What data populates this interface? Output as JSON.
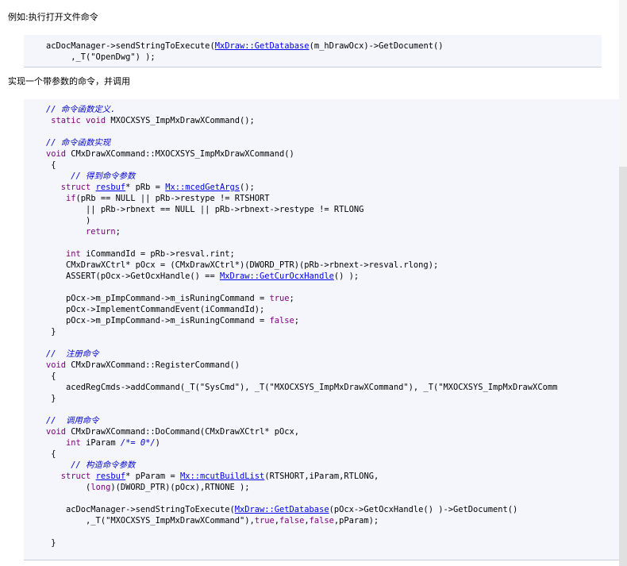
{
  "paragraph_1": "例如:执行打开文件命令",
  "code_1": [
    [
      [
        "t",
        "acDocManager->sendStringToExecute("
      ],
      [
        "l",
        "MxDraw::GetDatabase"
      ],
      [
        "t",
        "(m_hDrawOcx)->GetDocument()"
      ]
    ],
    [
      [
        "t",
        "     ,_T(\"OpenDwg\") );"
      ]
    ]
  ],
  "paragraph_2": "实现一个带参数的命令，并调用",
  "code_2": [
    [
      [
        "c",
        "// 命令函数定义."
      ]
    ],
    [
      [
        "t",
        " "
      ],
      [
        "k",
        "static void"
      ],
      [
        "t",
        " MXOCXSYS_ImpMxDrawXCommand();"
      ]
    ],
    [],
    [
      [
        "c",
        "// 命令函数实现"
      ]
    ],
    [
      [
        "k",
        "void"
      ],
      [
        "t",
        " CMxDrawXCommand::MXOCXSYS_ImpMxDrawXCommand()"
      ]
    ],
    [
      [
        "t",
        " {"
      ]
    ],
    [
      [
        "t",
        "     "
      ],
      [
        "c",
        "// 得到命令参数"
      ]
    ],
    [
      [
        "t",
        "   "
      ],
      [
        "k",
        "struct"
      ],
      [
        "t",
        " "
      ],
      [
        "l",
        "resbuf"
      ],
      [
        "t",
        "* pRb = "
      ],
      [
        "l",
        "Mx::mcedGetArgs"
      ],
      [
        "t",
        "();"
      ]
    ],
    [
      [
        "t",
        "    "
      ],
      [
        "k",
        "if"
      ],
      [
        "t",
        "(pRb == NULL || pRb->restype != RTSHORT"
      ]
    ],
    [
      [
        "t",
        "        || pRb->rbnext == NULL || pRb->rbnext->restype != RTLONG"
      ]
    ],
    [
      [
        "t",
        "        )"
      ]
    ],
    [
      [
        "t",
        "        "
      ],
      [
        "k",
        "return"
      ],
      [
        "t",
        ";"
      ]
    ],
    [],
    [
      [
        "t",
        "    "
      ],
      [
        "k",
        "int"
      ],
      [
        "t",
        " iCommandId = pRb->resval.rint;"
      ]
    ],
    [
      [
        "t",
        "    CMxDrawXCtrl* pOcx = (CMxDrawXCtrl*)(DWORD_PTR)(pRb->rbnext->resval.rlong);"
      ]
    ],
    [
      [
        "t",
        "    ASSERT(pOcx->GetOcxHandle() == "
      ],
      [
        "l",
        "MxDraw::GetCurOcxHandle"
      ],
      [
        "t",
        "() );"
      ]
    ],
    [],
    [
      [
        "t",
        "    pOcx->m_pImpCommand->m_isRuningCommand = "
      ],
      [
        "k",
        "true"
      ],
      [
        "t",
        ";"
      ]
    ],
    [
      [
        "t",
        "    pOcx->ImplementCommandEvent(iCommandId);"
      ]
    ],
    [
      [
        "t",
        "    pOcx->m_pImpCommand->m_isRuningCommand = "
      ],
      [
        "k",
        "false"
      ],
      [
        "t",
        ";"
      ]
    ],
    [
      [
        "t",
        " }"
      ]
    ],
    [],
    [
      [
        "c",
        "//  注册命令"
      ]
    ],
    [
      [
        "k",
        "void"
      ],
      [
        "t",
        " CMxDrawXCommand::RegisterCommand()"
      ]
    ],
    [
      [
        "t",
        " {"
      ]
    ],
    [
      [
        "t",
        "    acedRegCmds->addCommand(_T(\"SysCmd\"), _T(\"MXOCXSYS_ImpMxDrawXCommand\"), _T(\"MXOCXSYS_ImpMxDrawXComm"
      ]
    ],
    [
      [
        "t",
        " }"
      ]
    ],
    [],
    [
      [
        "c",
        "//  调用命令"
      ]
    ],
    [
      [
        "k",
        "void"
      ],
      [
        "t",
        " CMxDrawXCommand::DoCommand(CMxDrawXCtrl* pOcx,"
      ]
    ],
    [
      [
        "t",
        "    "
      ],
      [
        "k",
        "int"
      ],
      [
        "t",
        " iParam "
      ],
      [
        "c",
        "/*= 0*/"
      ],
      [
        "t",
        ")"
      ]
    ],
    [
      [
        "t",
        " {"
      ]
    ],
    [
      [
        "t",
        "     "
      ],
      [
        "c",
        "// 构造命令参数"
      ]
    ],
    [
      [
        "t",
        "   "
      ],
      [
        "k",
        "struct"
      ],
      [
        "t",
        " "
      ],
      [
        "l",
        "resbuf"
      ],
      [
        "t",
        "* pParam = "
      ],
      [
        "l",
        "Mx::mcutBuildList"
      ],
      [
        "t",
        "(RTSHORT,iParam,RTLONG,"
      ]
    ],
    [
      [
        "t",
        "        ("
      ],
      [
        "k",
        "long"
      ],
      [
        "t",
        ")(DWORD_PTR)(pOcx),RTNONE );"
      ]
    ],
    [],
    [
      [
        "t",
        "    acDocManager->sendStringToExecute("
      ],
      [
        "l",
        "MxDraw::GetDatabase"
      ],
      [
        "t",
        "(pOcx->GetOcxHandle() )->GetDocument()"
      ]
    ],
    [
      [
        "t",
        "        ,_T(\"MXOCXSYS_ImpMxDrawXCommand\"),"
      ],
      [
        "k",
        "true"
      ],
      [
        "t",
        ","
      ],
      [
        "k",
        "false"
      ],
      [
        "t",
        ","
      ],
      [
        "k",
        "false"
      ],
      [
        "t",
        ",pParam);"
      ]
    ],
    [],
    [
      [
        "t",
        " }"
      ]
    ]
  ],
  "colors": {
    "keyword": "#800080",
    "comment": "#0000cc",
    "link": "#0000ee",
    "code_background": "#f4f6fb"
  }
}
